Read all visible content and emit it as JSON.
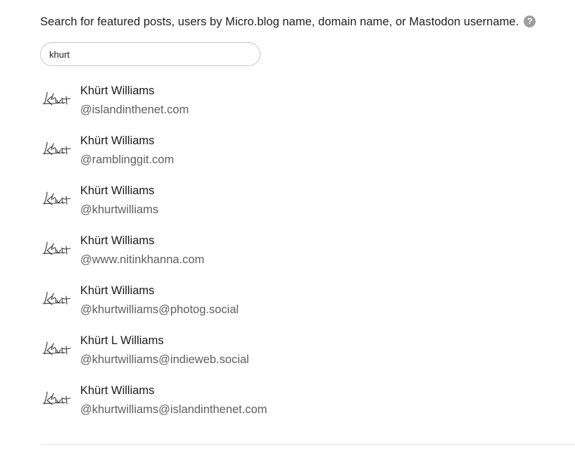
{
  "intro": {
    "text": "Search for featured posts, users by Micro.blog name, domain name, or Mastodon username.",
    "help_icon": "question-circle-icon",
    "help_glyph": "?"
  },
  "search": {
    "value": "khurt",
    "placeholder": ""
  },
  "results": [
    {
      "name": "Khürt Williams",
      "handle": "@islandinthenet.com",
      "avatar": "signature-avatar"
    },
    {
      "name": "Khürt Williams",
      "handle": "@ramblinggit.com",
      "avatar": "signature-avatar"
    },
    {
      "name": "Khürt Williams",
      "handle": "@khurtwilliams",
      "avatar": "signature-avatar"
    },
    {
      "name": "Khürt Williams",
      "handle": "@www.nitinkhanna.com",
      "avatar": "signature-avatar"
    },
    {
      "name": "Khürt Williams",
      "handle": "@khurtwilliams@photog.social",
      "avatar": "signature-avatar"
    },
    {
      "name": "Khürt L Williams",
      "handle": "@khurtwilliams@indieweb.social",
      "avatar": "signature-avatar"
    },
    {
      "name": "Khürt Williams",
      "handle": "@khurtwilliams@islandinthenet.com",
      "avatar": "signature-avatar"
    }
  ],
  "colors": {
    "text": "#222222",
    "handle": "#5f5f5f",
    "help_icon_bg": "#9e9e9e",
    "input_border": "#c6c6c6",
    "divider": "#e3e3e3"
  }
}
